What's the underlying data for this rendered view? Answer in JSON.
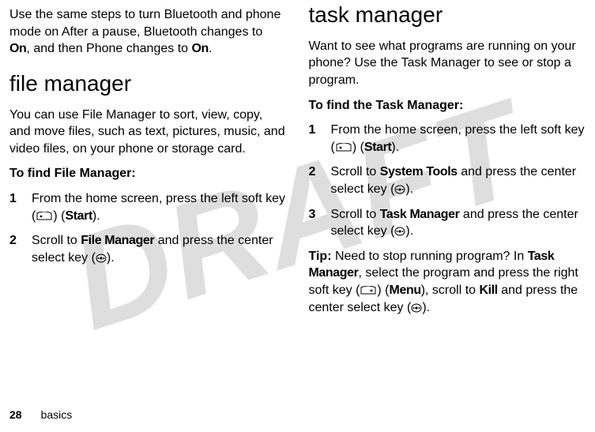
{
  "watermark": "DRAFT",
  "left": {
    "intro": "Use the same steps to turn Bluetooth and phone mode on After a pause, Bluetooth changes to ",
    "on1": "On",
    "intro2": ", and then Phone changes to ",
    "on2": "On",
    "filemgr_h": "file manager",
    "filemgr_p": "You can use File Manager to sort, view, copy, and move files, such as text, pictures, music, and video files, on your phone or storage card.",
    "filemgr_find": "To find File Manager:",
    "step1a": "From the home screen, press the left soft key (",
    "step1b": ") (",
    "start": "Start",
    "step1c": ").",
    "step2a": "Scroll to ",
    "filemgr_name": "File Manager",
    "step2b": " and press the center select key (",
    "step2c": ")."
  },
  "right": {
    "taskmgr_h": "task manager",
    "taskmgr_p": "Want to see what programs are running on your phone? Use the Task Manager to see or stop a program.",
    "taskmgr_find": "To find the Task Manager:",
    "r1a": "From the home screen, press the left soft key (",
    "r1b": ") (",
    "start": "Start",
    "r1c": ").",
    "r2a": "Scroll to ",
    "systools": "System Tools",
    "r2b": " and press the center select key (",
    "r2c": ").",
    "r3a": "Scroll to ",
    "taskmgr_name": "Task Manager",
    "r3b": " and press the center select key (",
    "r3c": ").",
    "tip_lead": "Tip:",
    "tip_a": " Need to stop running program? In ",
    "tip_b": ", select the program and press the right soft key (",
    "tip_c": ") (",
    "menu": "Menu",
    "tip_d": "), scroll to  ",
    "kill": "Kill",
    "tip_e": " and press the center select key (",
    "tip_f": ")."
  },
  "footer": {
    "page": "28",
    "section": "basics"
  }
}
